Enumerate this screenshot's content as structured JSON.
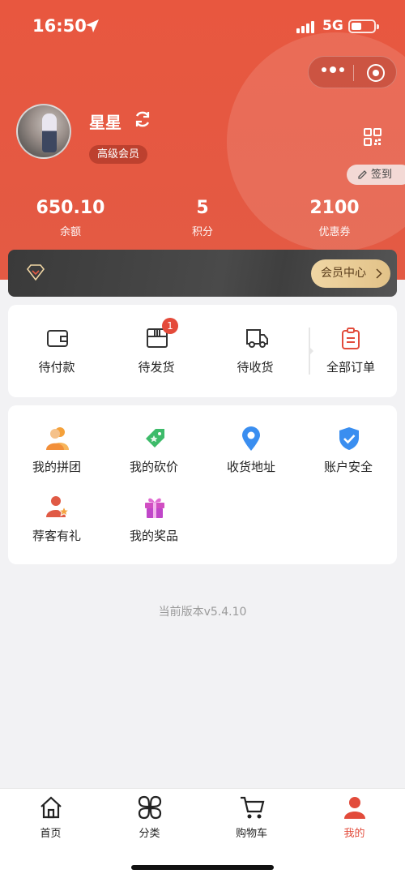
{
  "status_bar": {
    "time": "16:50",
    "network": "5G"
  },
  "profile": {
    "name": "星星",
    "member_level": "高级会员",
    "sign_in_label": "签到"
  },
  "stats": [
    {
      "value": "650.10",
      "label": "余额"
    },
    {
      "value": "5",
      "label": "积分"
    },
    {
      "value": "2100",
      "label": "优惠券"
    }
  ],
  "member_bar": {
    "button_label": "会员中心"
  },
  "orders": {
    "items": [
      {
        "label": "待付款",
        "icon": "wallet-icon"
      },
      {
        "label": "待发货",
        "icon": "package-icon",
        "badge": "1"
      },
      {
        "label": "待收货",
        "icon": "truck-icon"
      },
      {
        "label": "全部订单",
        "icon": "clipboard-icon"
      }
    ]
  },
  "services": {
    "items": [
      {
        "label": "我的拼团",
        "icon": "group-icon"
      },
      {
        "label": "我的砍价",
        "icon": "price-tag-icon"
      },
      {
        "label": "收货地址",
        "icon": "location-pin-icon"
      },
      {
        "label": "账户安全",
        "icon": "shield-check-icon"
      },
      {
        "label": "荐客有礼",
        "icon": "user-star-icon"
      },
      {
        "label": "我的奖品",
        "icon": "gift-icon"
      }
    ]
  },
  "version_text": "当前版本v5.4.10",
  "tabbar": {
    "items": [
      {
        "label": "首页",
        "icon": "home-icon"
      },
      {
        "label": "分类",
        "icon": "category-icon"
      },
      {
        "label": "购物车",
        "icon": "cart-icon"
      },
      {
        "label": "我的",
        "icon": "user-icon",
        "active": true
      }
    ]
  },
  "colors": {
    "brand_red": "#e8573f",
    "gold": "#e2c288",
    "badge_red": "#e44a3a"
  }
}
